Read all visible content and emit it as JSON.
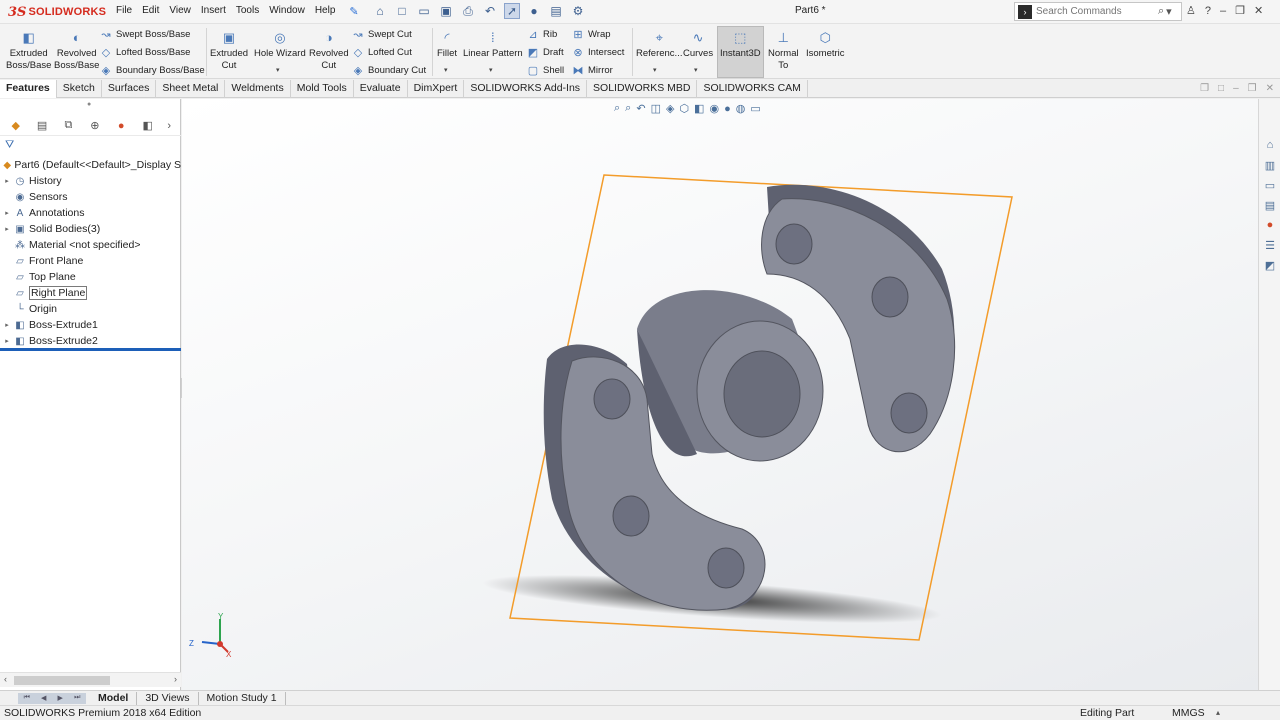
{
  "app": {
    "logo_ds": "3S",
    "brand": "SOLIDWORKS",
    "document_title": "Part6 *"
  },
  "menu": [
    "File",
    "Edit",
    "View",
    "Insert",
    "Tools",
    "Window",
    "Help"
  ],
  "search": {
    "placeholder": "Search Commands"
  },
  "command_manager": {
    "extruded_boss": "Extruded\nBoss/Base",
    "revolved_boss": "Revolved\nBoss/Base",
    "swept_boss": "Swept Boss/Base",
    "lofted_boss": "Lofted Boss/Base",
    "boundary_boss": "Boundary Boss/Base",
    "extruded_cut": "Extruded\nCut",
    "hole_wizard": "Hole Wizard",
    "revolved_cut": "Revolved\nCut",
    "swept_cut": "Swept Cut",
    "lofted_cut": "Lofted Cut",
    "boundary_cut": "Boundary Cut",
    "fillet": "Fillet",
    "linear_pattern": "Linear Pattern",
    "rib": "Rib",
    "draft": "Draft",
    "shell": "Shell",
    "wrap": "Wrap",
    "intersect": "Intersect",
    "mirror": "Mirror",
    "reference": "Referenc...",
    "curves": "Curves",
    "instant3d": "Instant3D",
    "normal_to": "Normal\nTo",
    "isometric": "Isometric"
  },
  "tabs": [
    "Features",
    "Sketch",
    "Surfaces",
    "Sheet Metal",
    "Weldments",
    "Mold Tools",
    "Evaluate",
    "DimXpert",
    "SOLIDWORKS Add-Ins",
    "SOLIDWORKS MBD",
    "SOLIDWORKS CAM"
  ],
  "feature_tree": {
    "root": "Part6  (Default<<Default>_Display S",
    "items": [
      {
        "label": "History",
        "expandable": true,
        "icon": "history-icon"
      },
      {
        "label": "Sensors",
        "expandable": false,
        "icon": "sensors-icon"
      },
      {
        "label": "Annotations",
        "expandable": true,
        "icon": "annotations-icon"
      },
      {
        "label": "Solid Bodies(3)",
        "expandable": true,
        "icon": "solid-bodies-icon"
      },
      {
        "label": "Material <not specified>",
        "expandable": false,
        "icon": "material-icon"
      },
      {
        "label": "Front Plane",
        "expandable": false,
        "icon": "plane-icon"
      },
      {
        "label": "Top Plane",
        "expandable": false,
        "icon": "plane-icon"
      },
      {
        "label": "Right Plane",
        "expandable": false,
        "icon": "plane-icon"
      },
      {
        "label": "Origin",
        "expandable": false,
        "icon": "origin-icon"
      },
      {
        "label": "Boss-Extrude1",
        "expandable": true,
        "icon": "extrude-feature-icon"
      },
      {
        "label": "Boss-Extrude2",
        "expandable": true,
        "icon": "extrude-feature-icon"
      }
    ]
  },
  "triad": {
    "x": "X",
    "y": "Y",
    "z": "Z"
  },
  "bottom_tabs": [
    "Model",
    "3D Views",
    "Motion Study 1"
  ],
  "status": {
    "edition": "SOLIDWORKS Premium 2018 x64 Edition",
    "mode": "Editing Part",
    "units": "MMGS"
  },
  "colors": {
    "brand_red": "#d52b1e",
    "plane_outline": "#f39c2a",
    "part_face": "#8a8d9a",
    "part_dark": "#5e6170",
    "rollback_bar": "#1d5fb8"
  }
}
